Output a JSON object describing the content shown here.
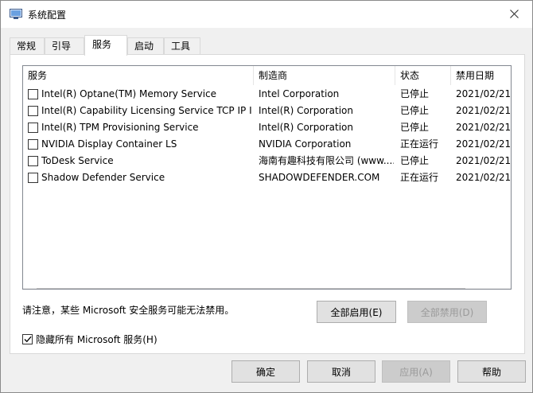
{
  "window": {
    "title": "系统配置"
  },
  "tabs": [
    {
      "label": "常规"
    },
    {
      "label": "引导"
    },
    {
      "label": "服务"
    },
    {
      "label": "启动"
    },
    {
      "label": "工具"
    }
  ],
  "columns": [
    "服务",
    "制造商",
    "状态",
    "禁用日期"
  ],
  "services": [
    {
      "name": "Intel(R) Optane(TM) Memory Service",
      "maker": "Intel Corporation",
      "status": "已停止",
      "date": "2021/02/21"
    },
    {
      "name": "Intel(R) Capability Licensing Service TCP IP I...",
      "maker": "Intel(R) Corporation",
      "status": "已停止",
      "date": "2021/02/21"
    },
    {
      "name": "Intel(R) TPM Provisioning Service",
      "maker": "Intel(R) Corporation",
      "status": "已停止",
      "date": "2021/02/21"
    },
    {
      "name": "NVIDIA Display Container LS",
      "maker": "NVIDIA Corporation",
      "status": "正在运行",
      "date": "2021/02/21"
    },
    {
      "name": "ToDesk Service",
      "maker": "海南有趣科技有限公司 (www....",
      "status": "已停止",
      "date": "2021/02/21"
    },
    {
      "name": "Shadow Defender Service",
      "maker": "SHADOWDEFENDER.COM",
      "status": "正在运行",
      "date": "2021/02/21"
    }
  ],
  "note": "请注意，某些 Microsoft 安全服务可能无法禁用。",
  "buttons": {
    "enable_all": "全部启用(E)",
    "disable_all": "全部禁用(D)",
    "ok": "确定",
    "cancel": "取消",
    "apply": "应用(A)",
    "help": "帮助"
  },
  "hide_ms": {
    "label": "隐藏所有 Microsoft 服务(H)",
    "checked": true
  }
}
